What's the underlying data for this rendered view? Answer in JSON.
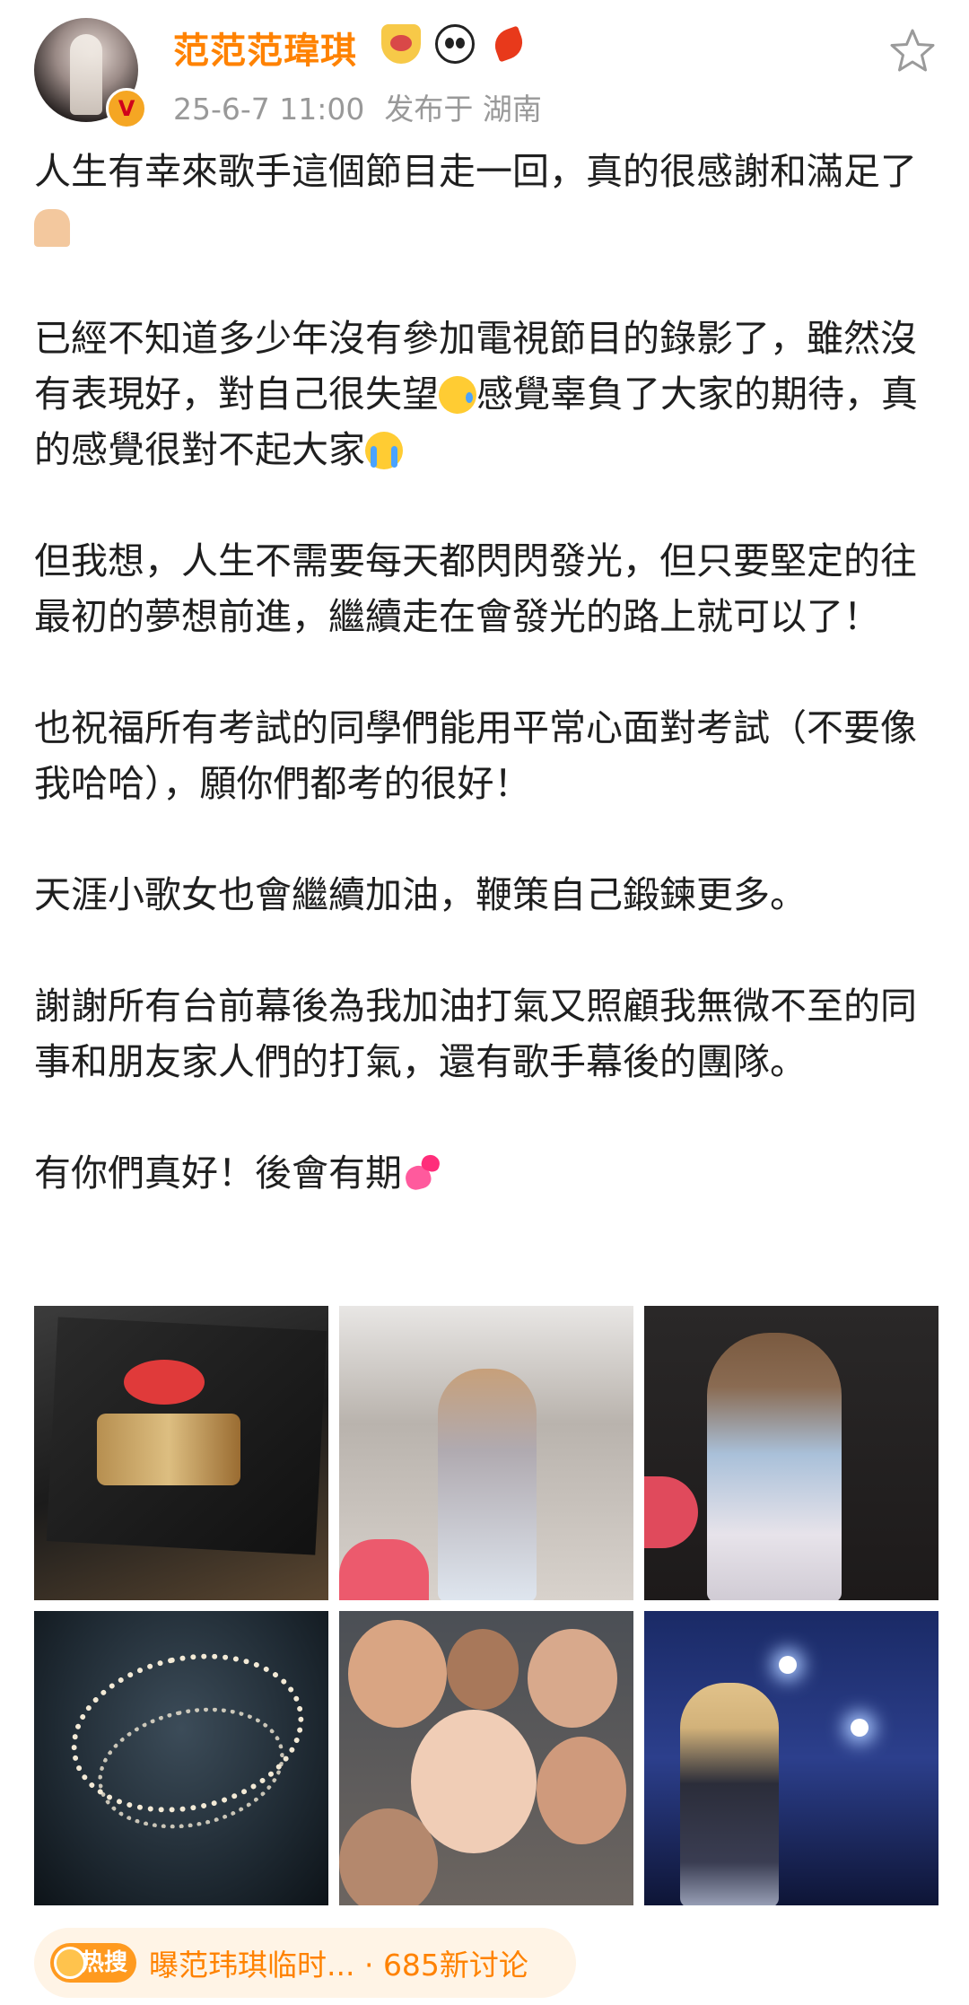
{
  "post": {
    "username": "范范范瑋琪",
    "meta": {
      "date": "25-6-7 11:00",
      "location": "发布于 湖南"
    },
    "icons": {
      "badges": [
        "crown-icon",
        "panda-icon",
        "dragon-icon"
      ],
      "favorite": "star-outline-icon",
      "verified": "verified-v-icon"
    },
    "badge_v": "V",
    "paragraphs": [
      {
        "text": "人生有幸來歌手這個節目走一回，真的很感謝和滿足了",
        "emoji": "folded-hands-emoji"
      },
      {
        "text_a": "已經不知道多少年沒有參加電視節目的錄影了，雖然沒有表現好，對自己很失望",
        "emoji_a": "smiling-face-with-tear-emoji",
        "text_b": "感覺辜負了大家的期待，真的感覺很對不起大家",
        "emoji_b": "loudly-crying-face-emoji"
      },
      {
        "text": "但我想，人生不需要每天都閃閃發光，但只要堅定的往最初的夢想前進，繼續走在會發光的路上就可以了！"
      },
      {
        "text": "也祝福所有考試的同學們能用平常心面對考試（不要像我哈哈），願你們都考的很好！"
      },
      {
        "text": "天涯小歌女也會繼續加油，鞭策自己鍛鍊更多。"
      },
      {
        "text": "謝謝所有台前幕後為我加油打氣又照顧我無微不至的同事和朋友家人們的打氣，還有歌手幕後的團隊。"
      },
      {
        "text": "有你們真好！後會有期",
        "emoji": "two-hearts-emoji"
      }
    ],
    "photos": [
      "photo-singer-2025-board",
      "photo-stage-blonde",
      "photo-stage-sweater",
      "photo-chandelier",
      "photo-group-selfie",
      "photo-stage-blue"
    ]
  },
  "hot_topic": {
    "badge_label": "热搜",
    "text": "曝范玮琪临时... · 685新讨论"
  },
  "colors": {
    "username": "#ff8200",
    "meta": "#999999",
    "body": "#1f1f1f",
    "hot_bg": "#fff4e6"
  }
}
